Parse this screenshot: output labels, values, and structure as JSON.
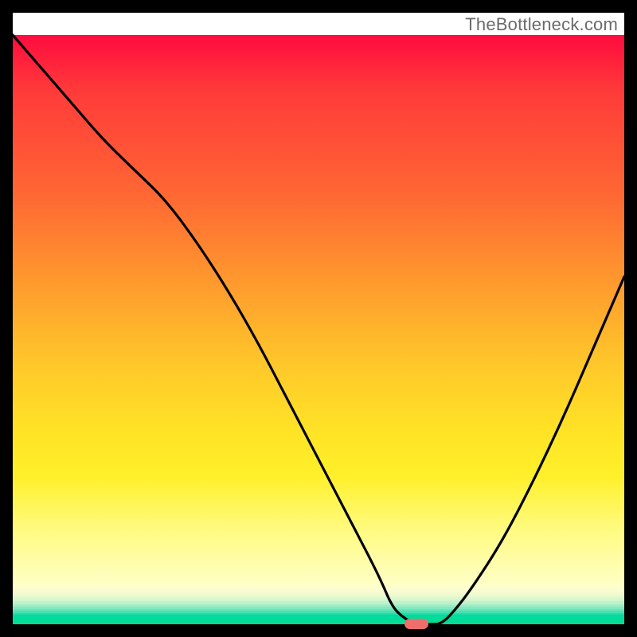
{
  "watermark": "TheBottleneck.com",
  "colors": {
    "frame": "#000000",
    "watermark_text": "#6a6a6a",
    "curve": "#000000",
    "marker": "#ef6e6b",
    "gradient_stops": [
      "#ff0c3e",
      "#ff3a3a",
      "#ff6a33",
      "#ff9a2e",
      "#ffc82a",
      "#ffe326",
      "#fff02a",
      "#fffb82",
      "#ffffc8"
    ],
    "bottom_bands": [
      "#fefdce",
      "#fcfccf",
      "#f9fcd0",
      "#f5fbcf",
      "#effad0",
      "#e7f9cf",
      "#ddf7cf",
      "#d0f5cd",
      "#c0f3cb",
      "#aef0c8",
      "#98edc5",
      "#80eac0",
      "#65e6ba",
      "#46e2b2",
      "#22dda9",
      "#00da9f",
      "#00dc9b",
      "#00dd98",
      "#00de96",
      "#00df94"
    ]
  },
  "chart_data": {
    "type": "line",
    "title": "",
    "xlabel": "",
    "ylabel": "",
    "xlim": [
      0,
      100
    ],
    "ylim": [
      0,
      100
    ],
    "x": [
      0,
      5,
      10,
      15,
      20,
      25,
      30,
      35,
      40,
      45,
      50,
      55,
      60,
      62,
      64,
      66,
      68,
      70,
      72,
      75,
      80,
      85,
      90,
      95,
      100
    ],
    "values": [
      100,
      94,
      88,
      82,
      77,
      72,
      65,
      57,
      48,
      38,
      28,
      18,
      8,
      3,
      1,
      0,
      0,
      0,
      2,
      6,
      14,
      24,
      35,
      47,
      59
    ],
    "marker": {
      "x_range": [
        64,
        68
      ],
      "y": 0
    },
    "description": "Bottleneck percentage curve. Vertical axis = bottleneck % (100 bad red at top, 0 good green at bottom). Curve minimum around x≈66 marked with a pink pill indicating the balanced point."
  }
}
